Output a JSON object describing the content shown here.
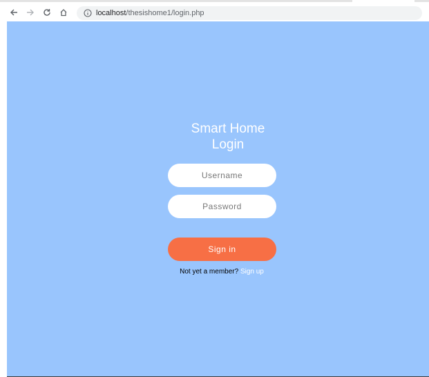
{
  "browser": {
    "url_host": "localhost",
    "url_path": "/thesishome1/login.php",
    "icons": {
      "back": "back-arrow-icon",
      "forward": "forward-arrow-icon",
      "reload": "reload-icon",
      "home": "home-icon",
      "info": "info-icon"
    }
  },
  "page": {
    "title_line1": "Smart Home",
    "title_line2": "Login",
    "username_placeholder": "Username",
    "password_placeholder": "Password",
    "signin_label": "Sign in",
    "member_prompt": "Not yet a member?",
    "signup_label": "Sign up"
  },
  "colors": {
    "background": "#99c5fd",
    "button": "#f76f45",
    "field": "#ffffff",
    "text_light": "#ffffff"
  }
}
